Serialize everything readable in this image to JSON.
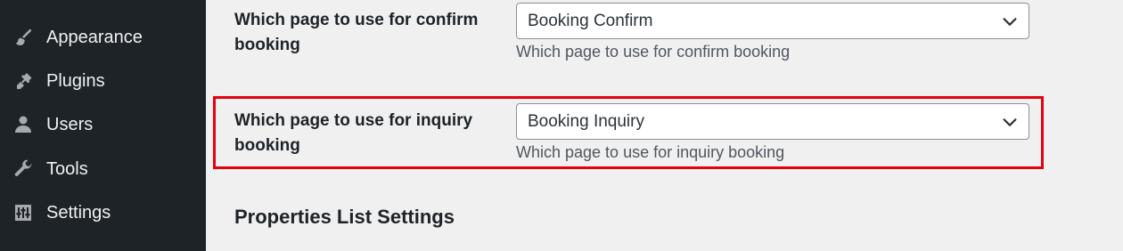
{
  "sidebar": {
    "items": [
      {
        "label": "Appearance",
        "icon": "paintbrush-icon"
      },
      {
        "label": "Plugins",
        "icon": "plug-icon"
      },
      {
        "label": "Users",
        "icon": "user-icon"
      },
      {
        "label": "Tools",
        "icon": "wrench-icon"
      },
      {
        "label": "Settings",
        "icon": "sliders-icon"
      }
    ]
  },
  "settings": {
    "confirm": {
      "label": "Which page to use for confirm booking",
      "selected": "Booking Confirm",
      "description": "Which page to use for confirm booking"
    },
    "inquiry": {
      "label": "Which page to use for inquiry booking",
      "selected": "Booking Inquiry",
      "description": "Which page to use for inquiry booking"
    }
  },
  "section": {
    "title": "Properties List Settings"
  },
  "colors": {
    "sidebar_bg": "#1d2327",
    "page_bg": "#f0f0f1",
    "highlight": "#e3000f"
  }
}
